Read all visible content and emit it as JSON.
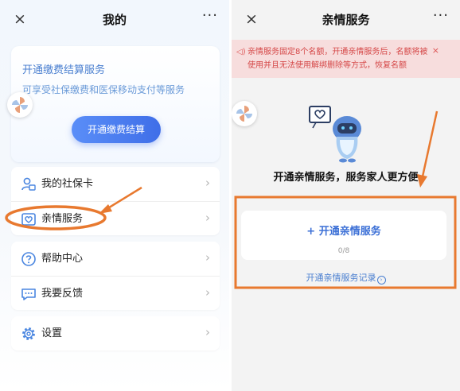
{
  "left": {
    "topbar": {
      "close_glyph": "×",
      "title": "我的",
      "more_glyph": "···"
    },
    "pay_card": {
      "heading": "开通缴费结算服务",
      "description": "可享受社保缴费和医保移动支付等服务",
      "button_label": "开通缴费结算"
    },
    "menu_group_1": [
      {
        "label": "我的社保卡",
        "icon": "social-card-icon"
      },
      {
        "label": "亲情服务",
        "icon": "heart-icon"
      }
    ],
    "menu_group_2": [
      {
        "label": "帮助中心",
        "icon": "help-icon"
      },
      {
        "label": "我要反馈",
        "icon": "feedback-icon"
      }
    ],
    "menu_group_3": [
      {
        "label": "设置",
        "icon": "settings-icon"
      }
    ],
    "chevron_glyph": "›"
  },
  "right": {
    "topbar": {
      "close_glyph": "×",
      "title": "亲情服务",
      "more_glyph": "···"
    },
    "notice": {
      "text": "亲情服务固定8个名额，开通亲情服务后，名额将被使用并且无法使用解绑删除等方式，恢复名额",
      "close_glyph": "×"
    },
    "hero_text": "开通亲情服务，服务家人更方便",
    "open_button_label": "+ 开通亲情服务",
    "quota": "0/8",
    "record_link": "开通亲情服务记录",
    "record_icon_glyph": "›"
  },
  "colors": {
    "accent_blue": "#3f6ee8",
    "annotation_orange": "#e8792f",
    "notice_bg": "#f7dddd",
    "notice_text": "#d54848"
  }
}
